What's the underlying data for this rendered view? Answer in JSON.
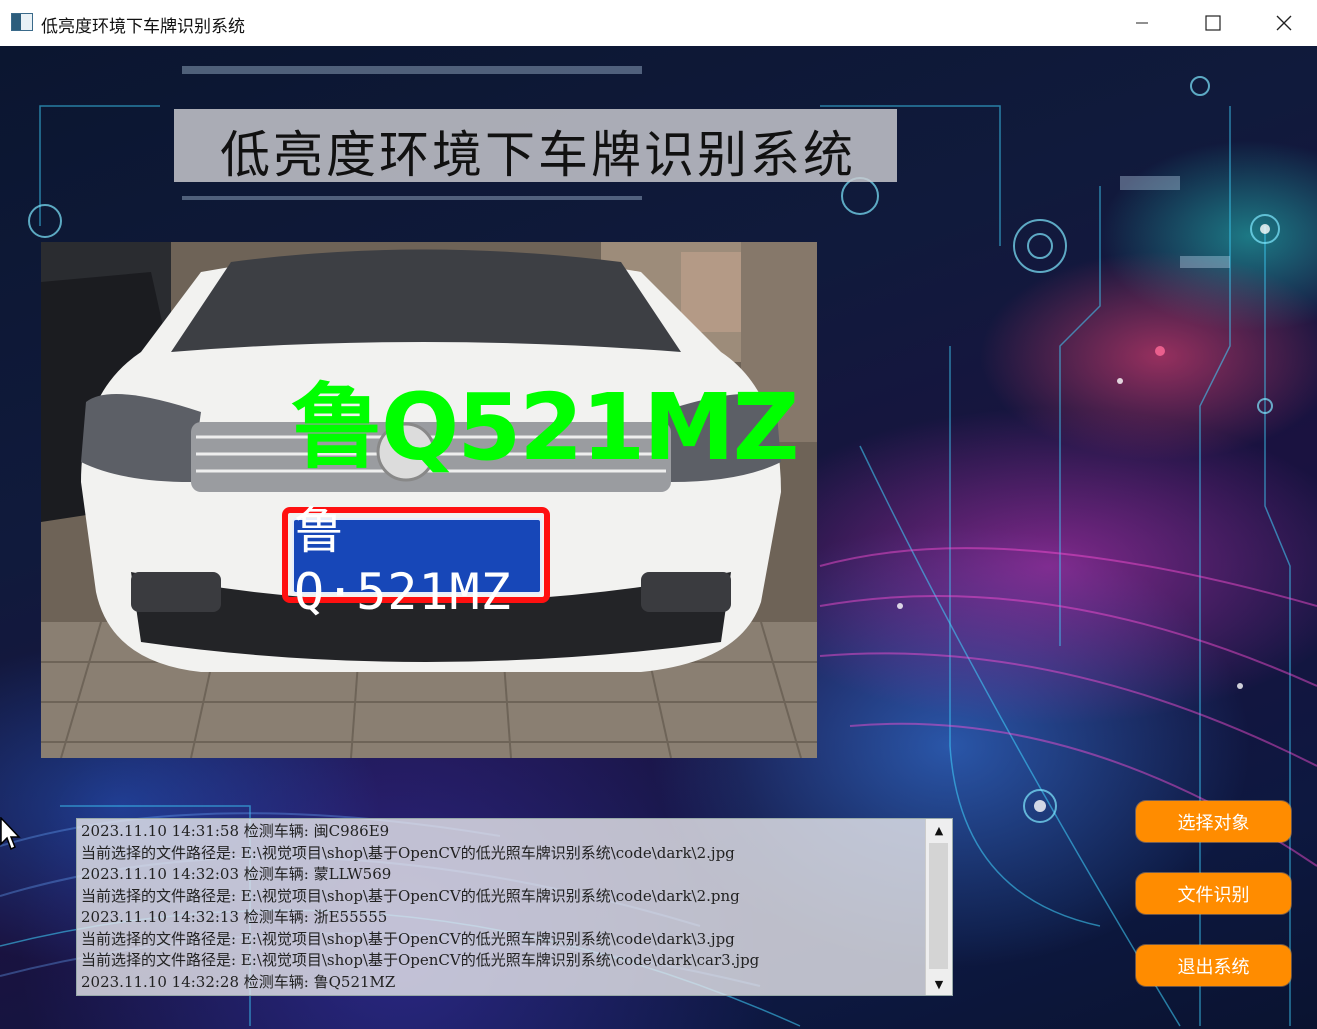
{
  "window": {
    "title": "低亮度环境下车牌识别系统",
    "controls": [
      "minimize",
      "maximize",
      "close"
    ]
  },
  "banner": {
    "title": "低亮度环境下车牌识别系统"
  },
  "detection": {
    "result_label": "鲁Q521MZ",
    "plate_text": "鲁Q·521MZ",
    "box_color": "#ff1010",
    "label_color": "#00ff00",
    "plate_color": "#1747b8"
  },
  "log": {
    "lines": [
      "2023.11.10 14:31:58 检测车辆: 闽C986E9",
      "当前选择的文件路径是: E:\\视觉项目\\shop\\基于OpenCV的低光照车牌识别系统\\code\\dark\\2.jpg",
      "2023.11.10 14:32:03 检测车辆: 蒙LLW569",
      "当前选择的文件路径是: E:\\视觉项目\\shop\\基于OpenCV的低光照车牌识别系统\\code\\dark\\2.png",
      "2023.11.10 14:32:13 检测车辆: 浙E55555",
      "当前选择的文件路径是: E:\\视觉项目\\shop\\基于OpenCV的低光照车牌识别系统\\code\\dark\\3.jpg",
      "当前选择的文件路径是: E:\\视觉项目\\shop\\基于OpenCV的低光照车牌识别系统\\code\\dark\\car3.jpg",
      "2023.11.10 14:32:28 检测车辆: 鲁Q521MZ"
    ],
    "scroll_up_glyph": "▲",
    "scroll_down_glyph": "▼"
  },
  "buttons": {
    "select_object": "选择对象",
    "file_recognize": "文件识别",
    "exit_system": "退出系统",
    "color": "#ff8c00"
  }
}
